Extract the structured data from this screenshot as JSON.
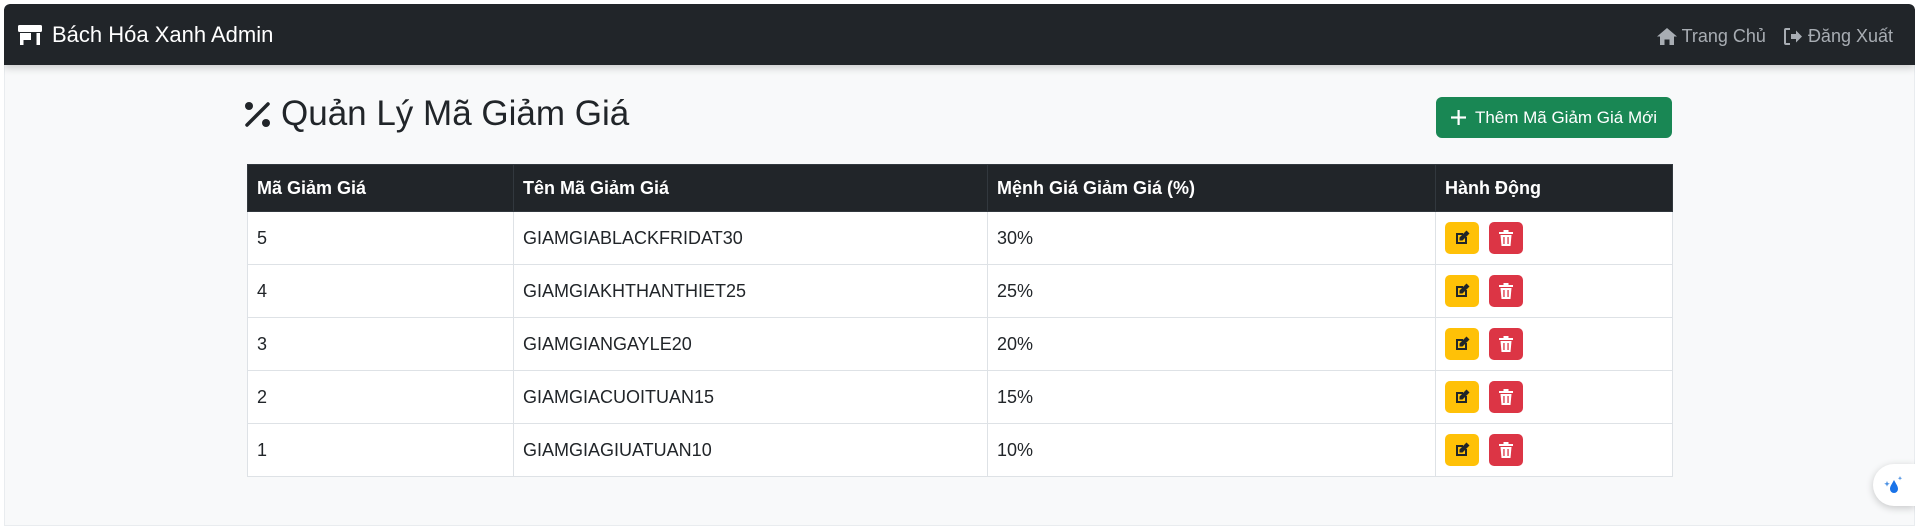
{
  "navbar": {
    "brand": "Bách Hóa Xanh Admin",
    "brand_icon": "store-icon",
    "links": [
      {
        "label": "Trang Chủ",
        "icon": "home-icon"
      },
      {
        "label": "Đăng Xuất",
        "icon": "logout-icon"
      }
    ]
  },
  "page": {
    "title": "Quản Lý Mã Giảm Giá",
    "title_icon": "percent-icon",
    "add_button_label": "Thêm Mã Giảm Giá Mới"
  },
  "table": {
    "headers": [
      "Mã Giảm Giá",
      "Tên Mã Giảm Giá",
      "Mệnh Giá Giảm Giá (%)",
      "Hành Động"
    ],
    "rows": [
      {
        "id": "5",
        "name": "GIAMGIABLACKFRIDAT30",
        "value": "30%"
      },
      {
        "id": "4",
        "name": "GIAMGIAKHTHANTHIET25",
        "value": "25%"
      },
      {
        "id": "3",
        "name": "GIAMGIANGAYLE20",
        "value": "20%"
      },
      {
        "id": "2",
        "name": "GIAMGIACUOITUAN15",
        "value": "15%"
      },
      {
        "id": "1",
        "name": "GIAMGIAGIUATUAN10",
        "value": "10%"
      }
    ]
  },
  "colors": {
    "navbar": "#212529",
    "success": "#198754",
    "warning": "#ffc107",
    "danger": "#dc3545"
  }
}
